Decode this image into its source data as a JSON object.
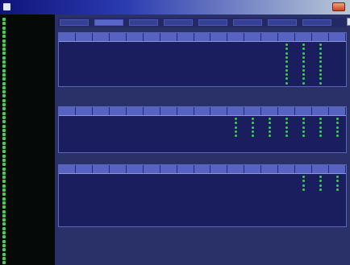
{
  "window": {
    "title": "",
    "toolbar_label": "",
    "toolbar_field": ""
  },
  "sidebar": {
    "items": [
      {
        "label": ""
      },
      {
        "label": ""
      },
      {
        "label": ""
      },
      {
        "label": ""
      },
      {
        "label": ""
      },
      {
        "label": ""
      },
      {
        "label": ""
      },
      {
        "label": ""
      },
      {
        "label": ""
      },
      {
        "label": ""
      },
      {
        "label": ""
      },
      {
        "label": ""
      },
      {
        "label": ""
      },
      {
        "label": ""
      },
      {
        "label": ""
      },
      {
        "label": ""
      },
      {
        "label": ""
      },
      {
        "label": ""
      },
      {
        "label": ""
      },
      {
        "label": ""
      },
      {
        "label": ""
      },
      {
        "label": ""
      },
      {
        "label": ""
      },
      {
        "label": ""
      },
      {
        "label": ""
      },
      {
        "label": ""
      },
      {
        "label": ""
      },
      {
        "label": ""
      },
      {
        "label": ""
      },
      {
        "label": ""
      },
      {
        "label": ""
      },
      {
        "label": ""
      },
      {
        "label": ""
      },
      {
        "label": ""
      },
      {
        "label": ""
      },
      {
        "label": ""
      },
      {
        "label": ""
      },
      {
        "label": ""
      },
      {
        "label": ""
      },
      {
        "label": ""
      },
      {
        "label": ""
      },
      {
        "label": ""
      },
      {
        "label": ""
      },
      {
        "label": ""
      },
      {
        "label": ""
      },
      {
        "label": ""
      },
      {
        "label": ""
      },
      {
        "label": ""
      },
      {
        "label": ""
      },
      {
        "label": ""
      },
      {
        "label": ""
      },
      {
        "label": ""
      },
      {
        "label": ""
      },
      {
        "label": ""
      },
      {
        "label": ""
      },
      {
        "label": ""
      },
      {
        "label": ""
      },
      {
        "label": ""
      }
    ]
  },
  "tabs": [
    {
      "label": "",
      "active": false
    },
    {
      "label": "",
      "active": true
    },
    {
      "label": "",
      "active": false
    },
    {
      "label": "",
      "active": false
    },
    {
      "label": "",
      "active": false
    },
    {
      "label": "",
      "active": false
    },
    {
      "label": "",
      "active": false
    },
    {
      "label": "",
      "active": false
    }
  ],
  "grids": [
    {
      "name": "top-grid",
      "columns": [
        "",
        "",
        "",
        "",
        "",
        "",
        "",
        "",
        "",
        "",
        "",
        "",
        "",
        "",
        "",
        "",
        ""
      ],
      "status_columns": [
        13,
        14,
        15
      ],
      "rows": [
        [
          "",
          "",
          "",
          "",
          "",
          "",
          "",
          "",
          "",
          "",
          "",
          "",
          "",
          "",
          "",
          "",
          ""
        ],
        [
          "",
          "",
          "",
          "",
          "",
          "",
          "",
          "",
          "",
          "",
          "",
          "",
          "",
          "",
          "",
          "",
          ""
        ],
        [
          "",
          "",
          "",
          "",
          "",
          "",
          "",
          "",
          "",
          "",
          "",
          "",
          "",
          "",
          "",
          "",
          ""
        ],
        [
          "",
          "",
          "",
          "",
          "",
          "",
          "",
          "",
          "",
          "",
          "",
          "",
          "",
          "",
          "",
          "",
          ""
        ],
        [
          "",
          "",
          "",
          "",
          "",
          "",
          "",
          "",
          "",
          "",
          "",
          "",
          "",
          "",
          "",
          "",
          ""
        ],
        [
          "",
          "",
          "",
          "",
          "",
          "",
          "",
          "",
          "",
          "",
          "",
          "",
          "",
          "",
          "",
          "",
          ""
        ],
        [
          "",
          "",
          "",
          "",
          "",
          "",
          "",
          "",
          "",
          "",
          "",
          "",
          "",
          "",
          "",
          "",
          ""
        ],
        [
          "",
          "",
          "",
          "",
          "",
          "",
          "",
          "",
          "",
          "",
          "",
          "",
          "",
          "",
          "",
          "",
          ""
        ],
        [
          "",
          "",
          "",
          "",
          "",
          "",
          "",
          "",
          "",
          "",
          "",
          "",
          "",
          "",
          "",
          "",
          ""
        ],
        [
          "",
          "",
          "",
          "",
          "",
          "",
          "",
          "",
          "",
          "",
          "",
          "",
          "",
          "",
          "",
          "",
          ""
        ]
      ]
    },
    {
      "name": "middle-grid",
      "columns": [
        "",
        "",
        "",
        "",
        "",
        "",
        "",
        "",
        "",
        "",
        "",
        "",
        "",
        "",
        "",
        "",
        ""
      ],
      "status_columns": [
        10,
        11,
        12,
        13,
        14,
        15,
        16
      ],
      "rows": [
        [
          "",
          "",
          "",
          "",
          "",
          "",
          "",
          "",
          "",
          "",
          "",
          "",
          "",
          "",
          "",
          "",
          ""
        ],
        [
          "",
          "",
          "",
          "",
          "",
          "",
          "",
          "",
          "",
          "",
          "",
          "",
          "",
          "",
          "",
          "",
          ""
        ],
        [
          "",
          "",
          "",
          "",
          "",
          "",
          "",
          "",
          "",
          "",
          "",
          "",
          "",
          "",
          "",
          "",
          ""
        ],
        [
          "",
          "",
          "",
          "",
          "",
          "",
          "",
          "",
          "",
          "",
          "",
          "",
          "",
          "",
          "",
          "",
          ""
        ],
        [
          "",
          "",
          "",
          "",
          "",
          "",
          "",
          "",
          "",
          "",
          "",
          "",
          "",
          "",
          "",
          "",
          ""
        ]
      ]
    },
    {
      "name": "bottom-grid",
      "columns": [
        "",
        "",
        "",
        "",
        "",
        "",
        "",
        "",
        "",
        "",
        "",
        "",
        "",
        "",
        "",
        "",
        ""
      ],
      "status_columns": [
        14,
        15,
        16
      ],
      "rows": [
        [
          "",
          "",
          "",
          "",
          "",
          "",
          "",
          "",
          "",
          "",
          "",
          "",
          "",
          "",
          "",
          "",
          ""
        ],
        [
          "",
          "",
          "",
          "",
          "",
          "",
          "",
          "",
          "",
          "",
          "",
          "",
          "",
          "",
          "",
          "",
          ""
        ],
        [
          "",
          "",
          "",
          "",
          "",
          "",
          "",
          "",
          "",
          "",
          "",
          "",
          "",
          "",
          "",
          "",
          ""
        ],
        [
          "",
          "",
          "",
          "",
          "",
          "",
          "",
          "",
          "",
          "",
          "",
          "",
          "",
          "",
          "",
          "",
          ""
        ]
      ]
    }
  ],
  "colors": {
    "status_ok": "#39d24a",
    "panel_bg": "#1a1e5e",
    "header_bg": "#5663c0",
    "sidebar_bg": "#050a08",
    "accent_green": "#3fd24a"
  }
}
